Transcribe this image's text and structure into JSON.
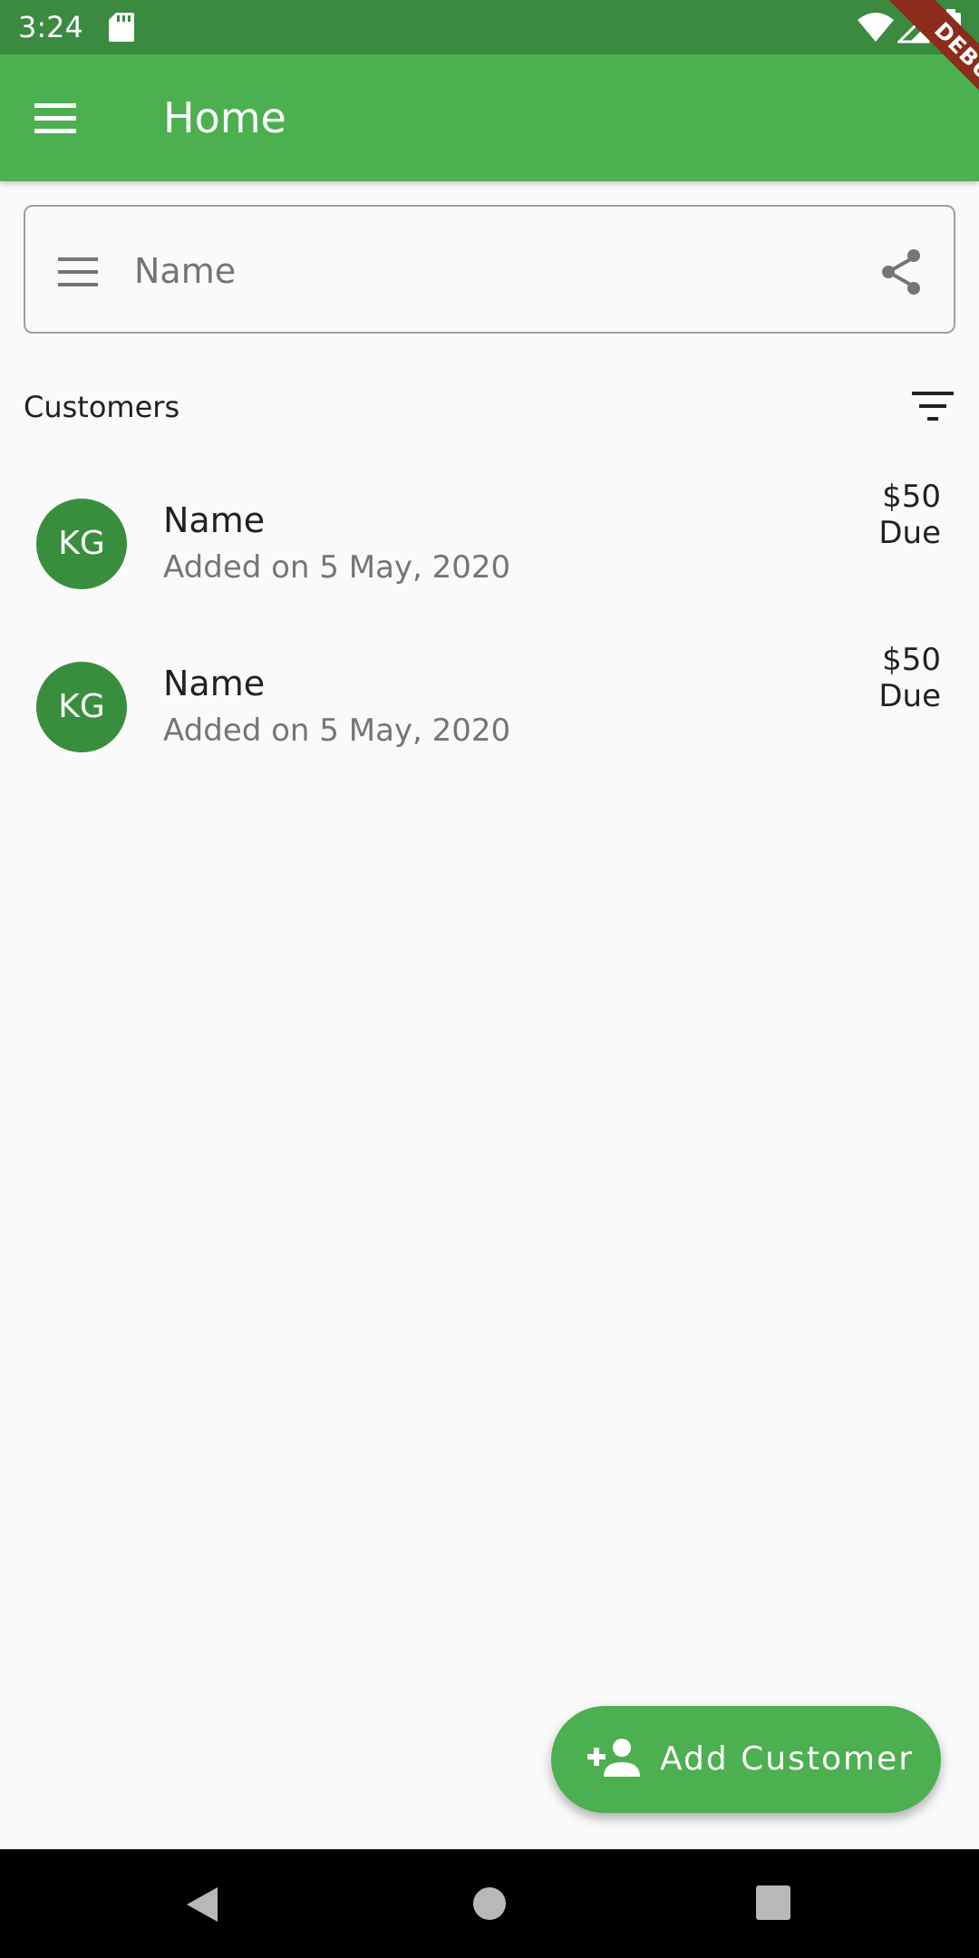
{
  "status_bar": {
    "time": "3:24",
    "icons": [
      "sd-card-icon",
      "wifi-icon",
      "signal-icon",
      "battery-icon"
    ]
  },
  "debug_banner": "DEBUG",
  "app_bar": {
    "title": "Home",
    "menu_icon": "menu-icon",
    "color": "#4caf50"
  },
  "search": {
    "placeholder": "Name",
    "leading_icon": "menu-icon",
    "trailing_icon": "share-icon"
  },
  "customers_section": {
    "title": "Customers",
    "filter_icon": "filter-icon"
  },
  "customers": [
    {
      "initials": "KG",
      "name": "Name",
      "added": "Added on 5 May, 2020",
      "amount": "$50",
      "status": "Due"
    },
    {
      "initials": "KG",
      "name": "Name",
      "added": "Added on 5 May, 2020",
      "amount": "$50",
      "status": "Due"
    }
  ],
  "fab": {
    "label": "Add Customer",
    "icon": "person-add-icon"
  },
  "nav_bar": {
    "icons": [
      "back-icon",
      "home-icon",
      "recents-icon"
    ]
  },
  "colors": {
    "primary": "#4caf50",
    "status_bar": "#3a8a40",
    "avatar": "#388e3c",
    "debug": "#8b2c1c"
  }
}
